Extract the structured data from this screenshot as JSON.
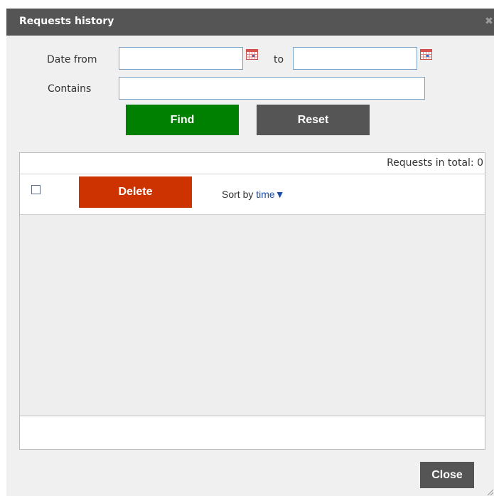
{
  "dialog": {
    "title": "Requests history",
    "close_icon": "close-icon"
  },
  "filters": {
    "date_from_label": "Date from",
    "date_from_value": "",
    "to_label": "to",
    "date_to_value": "",
    "contains_label": "Contains",
    "contains_value": "",
    "calendar_icon": "calendar-icon"
  },
  "buttons": {
    "find_label": "Find",
    "reset_label": "Reset",
    "delete_label": "Delete",
    "close_label": "Close"
  },
  "list": {
    "total_text": "Requests in total: 0",
    "sort_label": "Sort by",
    "sort_field": "time",
    "sort_direction": "▼"
  },
  "colors": {
    "titlebar": "#555555",
    "find": "#008000",
    "reset": "#555555",
    "delete": "#cc3300",
    "close": "#555555"
  }
}
